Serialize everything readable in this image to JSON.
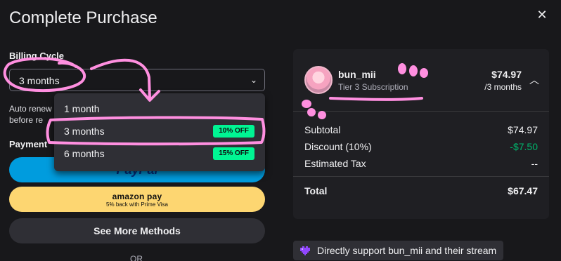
{
  "modal": {
    "title": "Complete Purchase",
    "close_icon": "close-icon"
  },
  "billing": {
    "label": "Billing Cycle",
    "selected": "3 months",
    "auto_renew_text": "Auto renew before re"
  },
  "dropdown": {
    "options": [
      {
        "label": "1 month",
        "badge": ""
      },
      {
        "label": "3 months",
        "badge": "10% OFF"
      },
      {
        "label": "6 months",
        "badge": "15% OFF"
      }
    ]
  },
  "payment": {
    "label": "Payment",
    "paypal_label": "PayPal",
    "amazon_label": "amazon pay",
    "amazon_sub": "5% back with Prime Visa",
    "more_label": "See More Methods",
    "or_label": "OR"
  },
  "summary": {
    "username": "bun_mii",
    "tier": "Tier 3 Subscription",
    "price": "$74.97",
    "period": "/3 months",
    "rows": [
      {
        "label": "Subtotal",
        "value": "$74.97"
      },
      {
        "label": "Discount (10%)",
        "value": "-$7.50"
      },
      {
        "label": "Estimated Tax",
        "value": "--"
      }
    ],
    "total_label": "Total",
    "total_value": "$67.47"
  },
  "support": {
    "text": "Directly support bun_mii and their stream"
  },
  "colors": {
    "background": "#18181b",
    "card": "#1f1f23",
    "badge": "#00f593",
    "discount": "#00b36b",
    "annotation": "#ff8fe0"
  }
}
